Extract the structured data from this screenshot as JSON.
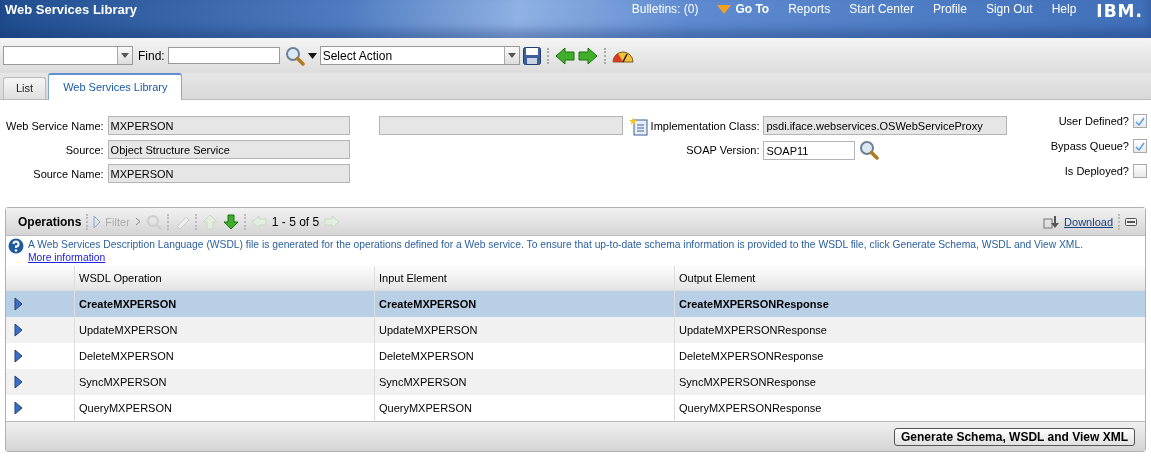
{
  "header": {
    "title": "Web Services Library",
    "nav": [
      {
        "label": "Bulletins: (0)",
        "kind": "text"
      },
      {
        "label": "Go To",
        "kind": "menu"
      },
      {
        "label": "Reports",
        "kind": "link"
      },
      {
        "label": "Start Center",
        "kind": "link"
      },
      {
        "label": "Profile",
        "kind": "link"
      },
      {
        "label": "Sign Out",
        "kind": "link"
      },
      {
        "label": "Help",
        "kind": "link"
      }
    ],
    "logo": "IBM."
  },
  "toolbar": {
    "find_label": "Find:",
    "action_select": "Select Action"
  },
  "tabs": [
    {
      "label": "List",
      "selected": false
    },
    {
      "label": "Web Services Library",
      "selected": true
    }
  ],
  "form": {
    "left_fields": [
      {
        "label": "Web Service Name:",
        "value": "MXPERSON"
      },
      {
        "label": "Source:",
        "value": "Object Structure Service"
      },
      {
        "label": "Source Name:",
        "value": "MXPERSON"
      }
    ],
    "implementation_class": {
      "label": "Implementation Class:",
      "value": "psdi.iface.webservices.OSWebServiceProxy"
    },
    "soap_version": {
      "label": "SOAP Version:",
      "value": "SOAP11"
    },
    "checkboxes": [
      {
        "label": "User Defined?",
        "checked": true
      },
      {
        "label": "Bypass Queue?",
        "checked": true
      },
      {
        "label": "Is Deployed?",
        "checked": false
      }
    ]
  },
  "operations": {
    "title": "Operations",
    "filter": {
      "label": "Filter",
      "disabled": true
    },
    "pager": "1 - 5 of 5",
    "download": "Download",
    "info": "A Web Services Description Language (WSDL) file is generated for the operations defined for a Web service. To ensure that up-to-date schema information is provided to the WSDL file, click Generate Schema, WSDL and View XML.",
    "more_info": "More information",
    "columns": [
      "WSDL Operation",
      "Input Element",
      "Output Element"
    ],
    "rows": [
      {
        "cells": [
          "CreateMXPERSON",
          "CreateMXPERSON",
          "CreateMXPERSONResponse"
        ],
        "selected": true
      },
      {
        "cells": [
          "UpdateMXPERSON",
          "UpdateMXPERSON",
          "UpdateMXPERSONResponse"
        ],
        "selected": false
      },
      {
        "cells": [
          "DeleteMXPERSON",
          "DeleteMXPERSON",
          "DeleteMXPERSONResponse"
        ],
        "selected": false
      },
      {
        "cells": [
          "SyncMXPERSON",
          "SyncMXPERSON",
          "SyncMXPERSONResponse"
        ],
        "selected": false
      },
      {
        "cells": [
          "QueryMXPERSON",
          "QueryMXPERSON",
          "QueryMXPERSONResponse"
        ],
        "selected": false
      }
    ],
    "button": "Generate Schema, WSDL and View XML"
  }
}
